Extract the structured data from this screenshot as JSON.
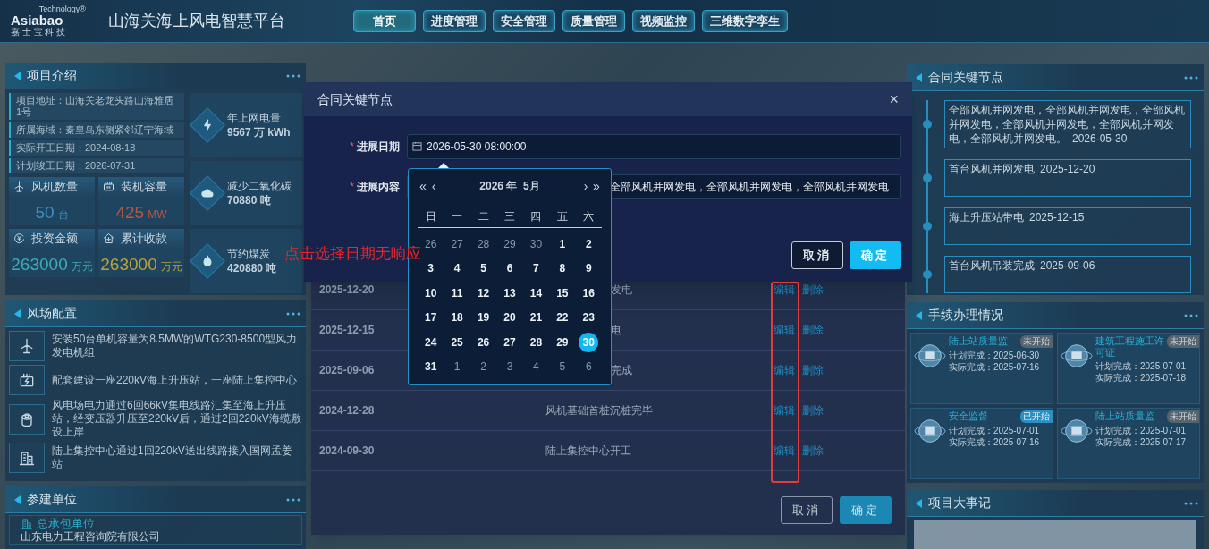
{
  "header": {
    "logo": {
      "brand": "Asiabao",
      "tagline": "Technology®",
      "subtitle": "嘉 士 宝 科 技"
    },
    "title": "山海关海上风电智慧平台",
    "nav": [
      {
        "label": "首页",
        "selected": true
      },
      {
        "label": "进度管理",
        "selected": false
      },
      {
        "label": "安全管理",
        "selected": false
      },
      {
        "label": "质量管理",
        "selected": false
      },
      {
        "label": "视频监控",
        "selected": false
      },
      {
        "label": "三维数字孪生",
        "selected": false
      }
    ]
  },
  "project_intro": {
    "title": "项目介绍",
    "info": [
      "项目地址：山海关老龙头路山海雅居1号",
      "所属海域：秦皇岛东侧紧邻辽宁海域",
      "实际开工日期：2024-08-18",
      "计划竣工日期：2026-07-31"
    ],
    "tiles": [
      {
        "kind": "turbine",
        "label": "风机数量",
        "value": "50",
        "unit": "台",
        "color": "#3e8fbf"
      },
      {
        "kind": "battery",
        "label": "装机容量",
        "value": "425",
        "unit": "MW",
        "color": "#b5583f"
      },
      {
        "kind": "coin",
        "label": "投资金额",
        "value": "263000",
        "unit": "万元",
        "color": "#3fa9b8"
      },
      {
        "kind": "house",
        "label": "累计收款",
        "value": "263000",
        "unit": "万元",
        "color": "#b8a23a"
      }
    ],
    "stats": [
      {
        "kind": "bolt",
        "label": "年上网电量",
        "value": "9567 万 kWh"
      },
      {
        "kind": "cloud",
        "label": "减少二氧化碳",
        "value": "70880 吨"
      },
      {
        "kind": "flame",
        "label": "节约煤炭",
        "value": "420880 吨"
      }
    ]
  },
  "wind_farm": {
    "title": "风场配置",
    "items": [
      {
        "kind": "turbine",
        "text": "安装50台单机容量为8.5MW的WTG230-8500型风力发电机组"
      },
      {
        "kind": "substation",
        "text": "配套建设一座220kV海上升压站，一座陆上集控中心"
      },
      {
        "kind": "cable",
        "text": "风电场电力通过6回66kV集电线路汇集至海上升压站，经变压器升压至220kV后，通过2回220kV海缆敷设上岸"
      },
      {
        "kind": "building",
        "text": "陆上集控中心通过1回220kV送出线路接入国网孟姜站"
      }
    ]
  },
  "participants": {
    "title": "参建单位",
    "role": "总承包单位",
    "company": "山东电力工程咨询院有限公司"
  },
  "milestones": {
    "title": "合同关键节点",
    "items": [
      {
        "text": "全部风机并网发电，全部风机并网发电，全部风机并网发电，全部风机并网发电，全部风机并网发电，全部风机并网发电。",
        "date": "2026-05-30"
      },
      {
        "text": "首台风机并网发电",
        "date": "2025-12-20"
      },
      {
        "text": "海上升压站带电",
        "date": "2025-12-15"
      },
      {
        "text": "首台风机吊装完成",
        "date": "2025-09-06"
      }
    ]
  },
  "procedures": {
    "title": "手续办理情况",
    "items": [
      {
        "name": "陆上站质量监",
        "status": "未开始",
        "started": false,
        "planned": "计划完成：2025-06-30",
        "actual": "实际完成：2025-07-16"
      },
      {
        "name": "建筑工程施工许可证",
        "status": "未开始",
        "started": false,
        "planned": "计划完成：2025-07-01",
        "actual": "实际完成：2025-07-18"
      },
      {
        "name": "安全监督",
        "status": "已开始",
        "started": true,
        "planned": "计划完成：2025-07-01",
        "actual": "实际完成：2025-07-16"
      },
      {
        "name": "陆上站质量监",
        "status": "未开始",
        "started": false,
        "planned": "计划完成：2025-07-01",
        "actual": "实际完成：2025-07-17"
      }
    ]
  },
  "events": {
    "title": "项目大事记"
  },
  "list_dialog": {
    "rows": [
      {
        "date": "2025-12-20",
        "content": "发电",
        "kind": "partial",
        "actions": [
          "编辑",
          "删除"
        ]
      },
      {
        "date": "2025-12-15",
        "content": "电",
        "kind": "partial",
        "actions": [
          "编辑",
          "删除"
        ]
      },
      {
        "date": "2025-09-06",
        "content": "完成",
        "kind": "partial",
        "actions": [
          "编辑",
          "删除"
        ]
      },
      {
        "date": "2024-12-28",
        "content": "风机基础首桩沉桩完毕",
        "kind": "full",
        "actions": [
          "编辑",
          "删除"
        ]
      },
      {
        "date": "2024-09-30",
        "content": "陆上集控中心开工",
        "kind": "full",
        "actions": [
          "编辑",
          "删除"
        ]
      }
    ],
    "buttons": [
      "取消",
      "确定"
    ]
  },
  "edit_dialog": {
    "title": "合同关键节点",
    "close": "×",
    "fields": [
      {
        "mark": "*",
        "label": "进展日期",
        "kind": "date",
        "value": "2026-05-30 08:00:00"
      },
      {
        "mark": "*",
        "label": "进展内容",
        "kind": "text",
        "value": "全部风机并网发电，全部风机并网发电，全部风机并网发电"
      }
    ],
    "buttons": [
      "取消",
      "确定"
    ]
  },
  "calendar": {
    "nav": [
      "«",
      "‹",
      "›",
      "»"
    ],
    "title": "2026 年  5月",
    "weekdays": [
      "日",
      "一",
      "二",
      "三",
      "四",
      "五",
      "六"
    ],
    "days": [
      {
        "label": "26",
        "kind": "other",
        "selected": false
      },
      {
        "label": "27",
        "kind": "other",
        "selected": false
      },
      {
        "label": "28",
        "kind": "other",
        "selected": false
      },
      {
        "label": "29",
        "kind": "other",
        "selected": false
      },
      {
        "label": "30",
        "kind": "other",
        "selected": false
      },
      {
        "label": "1",
        "kind": "current",
        "selected": false
      },
      {
        "label": "2",
        "kind": "current",
        "selected": false
      },
      {
        "label": "3",
        "kind": "current",
        "selected": false
      },
      {
        "label": "4",
        "kind": "current",
        "selected": false
      },
      {
        "label": "5",
        "kind": "current",
        "selected": false
      },
      {
        "label": "6",
        "kind": "current",
        "selected": false
      },
      {
        "label": "7",
        "kind": "current",
        "selected": false
      },
      {
        "label": "8",
        "kind": "current",
        "selected": false
      },
      {
        "label": "9",
        "kind": "current",
        "selected": false
      },
      {
        "label": "10",
        "kind": "current",
        "selected": false
      },
      {
        "label": "11",
        "kind": "current",
        "selected": false
      },
      {
        "label": "12",
        "kind": "current",
        "selected": false
      },
      {
        "label": "13",
        "kind": "current",
        "selected": false
      },
      {
        "label": "14",
        "kind": "current",
        "selected": false
      },
      {
        "label": "15",
        "kind": "current",
        "selected": false
      },
      {
        "label": "16",
        "kind": "current",
        "selected": false
      },
      {
        "label": "17",
        "kind": "current",
        "selected": false
      },
      {
        "label": "18",
        "kind": "current",
        "selected": false
      },
      {
        "label": "19",
        "kind": "current",
        "selected": false
      },
      {
        "label": "20",
        "kind": "current",
        "selected": false
      },
      {
        "label": "21",
        "kind": "current",
        "selected": false
      },
      {
        "label": "22",
        "kind": "current",
        "selected": false
      },
      {
        "label": "23",
        "kind": "current",
        "selected": false
      },
      {
        "label": "24",
        "kind": "current",
        "selected": false
      },
      {
        "label": "25",
        "kind": "current",
        "selected": false
      },
      {
        "label": "26",
        "kind": "current",
        "selected": false
      },
      {
        "label": "27",
        "kind": "current",
        "selected": false
      },
      {
        "label": "28",
        "kind": "current",
        "selected": false
      },
      {
        "label": "29",
        "kind": "current",
        "selected": false
      },
      {
        "label": "30",
        "kind": "current",
        "selected": true
      },
      {
        "label": "31",
        "kind": "current",
        "selected": false
      },
      {
        "label": "1",
        "kind": "other",
        "selected": false
      },
      {
        "label": "2",
        "kind": "other",
        "selected": false
      },
      {
        "label": "3",
        "kind": "other",
        "selected": false
      },
      {
        "label": "4",
        "kind": "other",
        "selected": false
      },
      {
        "label": "5",
        "kind": "other",
        "selected": false
      },
      {
        "label": "6",
        "kind": "other",
        "selected": false
      }
    ]
  },
  "annotation": {
    "note": "点击选择日期无响应"
  }
}
